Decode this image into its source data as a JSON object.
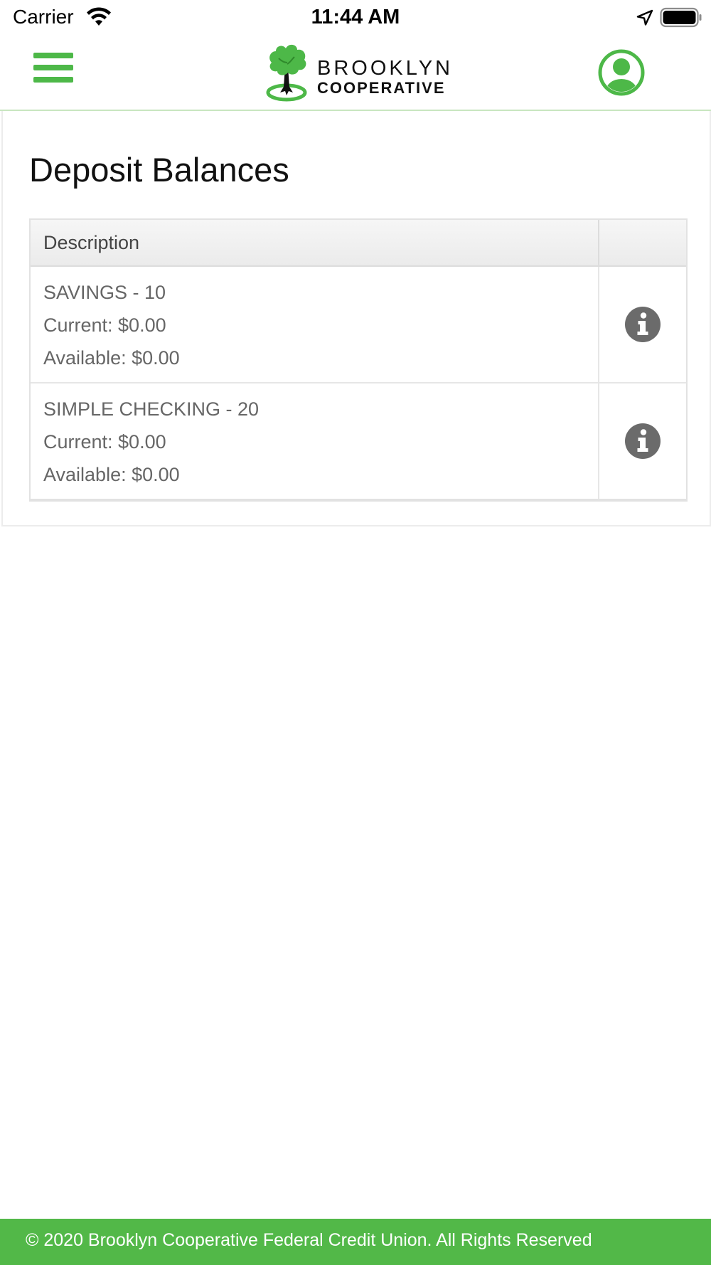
{
  "status_bar": {
    "carrier": "Carrier",
    "time": "11:44 AM"
  },
  "header": {
    "logo_line1": "BROOKLYN",
    "logo_line2": "COOPERATIVE",
    "brand_color": "#4db848"
  },
  "page": {
    "title": "Deposit Balances"
  },
  "table": {
    "columns": [
      "Description",
      ""
    ],
    "rows": [
      {
        "name": "SAVINGS - 10",
        "current": "Current: $0.00",
        "available": "Available: $0.00"
      },
      {
        "name": "SIMPLE CHECKING - 20",
        "current": "Current: $0.00",
        "available": "Available: $0.00"
      }
    ]
  },
  "footer": {
    "text": "© 2020 Brooklyn Cooperative Federal Credit Union. All Rights Reserved",
    "color": "#52b848"
  },
  "icons": [
    "wifi-icon",
    "location-arrow-icon",
    "battery-icon",
    "hamburger-menu-icon",
    "tree-logo-icon",
    "user-profile-icon",
    "info-icon"
  ]
}
